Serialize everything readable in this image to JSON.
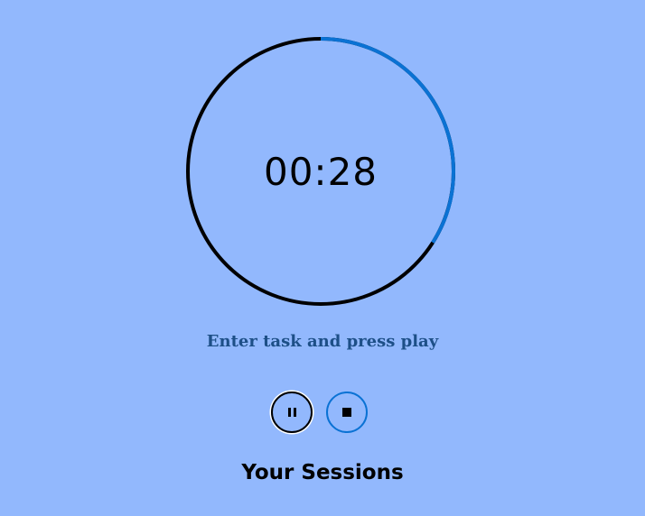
{
  "colors": {
    "background": "#92b8fd",
    "ring_track": "#000000",
    "ring_progress": "#0a72d4",
    "prompt_text": "#1d4f87",
    "stop_border": "#0a72d4",
    "pause_border": "#000000"
  },
  "timer": {
    "display": "00:28",
    "progress_fraction": 0.34
  },
  "task": {
    "prompt": "Enter task and press play"
  },
  "controls": {
    "pause_icon": "pause-icon",
    "stop_icon": "stop-icon"
  },
  "sessions": {
    "heading": "Your Sessions"
  }
}
